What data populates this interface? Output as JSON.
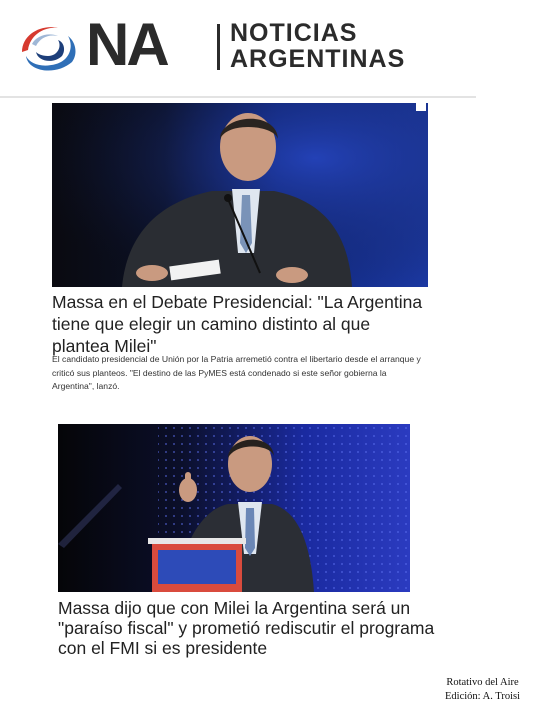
{
  "header": {
    "logo_mark": "NA",
    "logo_text_line1": "NOTICIAS",
    "logo_text_line2": "ARGENTINAS",
    "colors": {
      "swirl_red": "#d63a2f",
      "swirl_blue": "#2f6fb7",
      "swirl_navy": "#1d3f7a",
      "ink": "#2b2b2b"
    }
  },
  "articles": [
    {
      "headline": "Massa en el Debate Presidencial: \"La Argentina tiene que elegir un camino distinto al que plantea Milei\"",
      "summary": "El candidato presidencial de Unión por la Patria arremetió contra el libertario desde el arranque y criticó sus planteos. \"El destino de las PyMES está condenado si este señor gobierna la Argentina\", lanzó."
    },
    {
      "headline": "Massa dijo que con Milei la Argentina será un \"paraíso fiscal\" y prometió rediscutir el programa con el FMI si es presidente"
    }
  ],
  "footer": {
    "credit_line1": "Rotativo del Aire",
    "credit_line2": "Edición: A. Troisi"
  }
}
